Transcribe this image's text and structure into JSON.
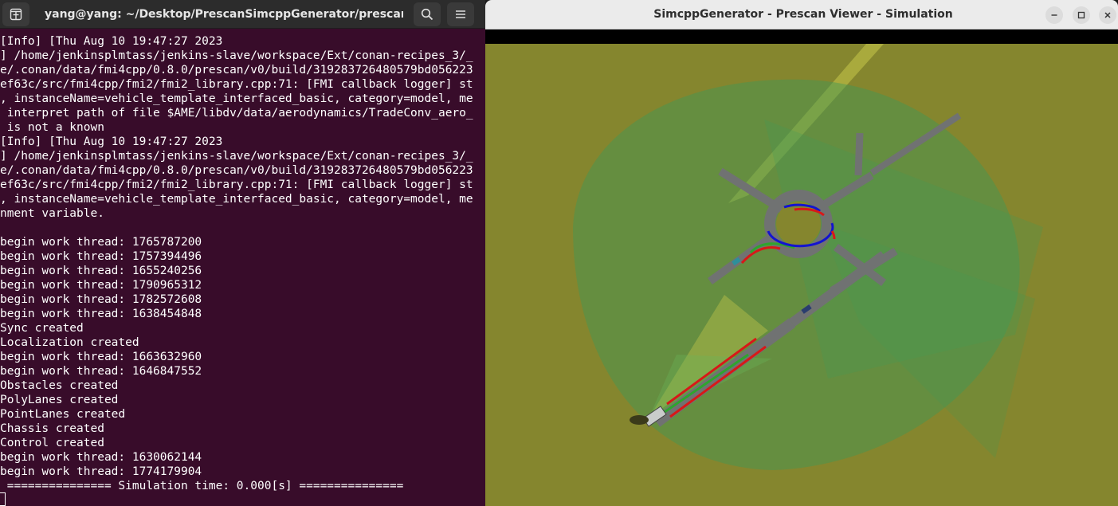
{
  "terminal": {
    "title": "yang@yang: ~/Desktop/PrescanSimcppGenerator/prescande...",
    "icons": {
      "new_tab": "new-tab-icon",
      "search": "search-icon",
      "menu": "hamburger-menu-icon"
    },
    "lines": [
      "[Info] [Thu Aug 10 19:47:27 2023",
      "] /home/jenkinsplmtass/jenkins-slave/workspace/Ext/conan-recipes_3/_",
      "e/.conan/data/fmi4cpp/0.8.0/prescan/v0/build/319283726480579bd056223",
      "ef63c/src/fmi4cpp/fmi2/fmi2_library.cpp:71: [FMI callback logger] st",
      ", instanceName=vehicle_template_interfaced_basic, category=model, me",
      " interpret path of file $AME/libdv/data/aerodynamics/TradeConv_aero_",
      " is not a known",
      "[Info] [Thu Aug 10 19:47:27 2023",
      "] /home/jenkinsplmtass/jenkins-slave/workspace/Ext/conan-recipes_3/_",
      "e/.conan/data/fmi4cpp/0.8.0/prescan/v0/build/319283726480579bd056223",
      "ef63c/src/fmi4cpp/fmi2/fmi2_library.cpp:71: [FMI callback logger] st",
      ", instanceName=vehicle_template_interfaced_basic, category=model, me",
      "nment variable.",
      "",
      "begin work thread: 1765787200",
      "begin work thread: 1757394496",
      "begin work thread: 1655240256",
      "begin work thread: 1790965312",
      "begin work thread: 1782572608",
      "begin work thread: 1638454848",
      "Sync created",
      "Localization created",
      "begin work thread: 1663632960",
      "begin work thread: 1646847552",
      "Obstacles created",
      "PolyLanes created",
      "PointLanes created",
      "Chassis created",
      "Control created",
      "begin work thread: 1630062144",
      "begin work thread: 1774179904",
      " =============== Simulation time: 0.000[s] ==============="
    ],
    "colors": {
      "background": "#380c2a",
      "text": "#ffffff",
      "header": "#2c2c2c"
    }
  },
  "viewer": {
    "title": "SimcppGenerator - Prescan Viewer - Simulation",
    "buttons": {
      "minimize": "minimize-icon",
      "maximize": "maximize-icon",
      "close": "close-icon"
    },
    "scene": {
      "ground_color": "#85862e",
      "sensor_cone_color": "#3f9a57",
      "road_color": "#707272",
      "planned_path_color": "#2ea52e",
      "lane_boundary_color": "#d81818",
      "roundabout_marker_color": "#1414d0"
    }
  }
}
